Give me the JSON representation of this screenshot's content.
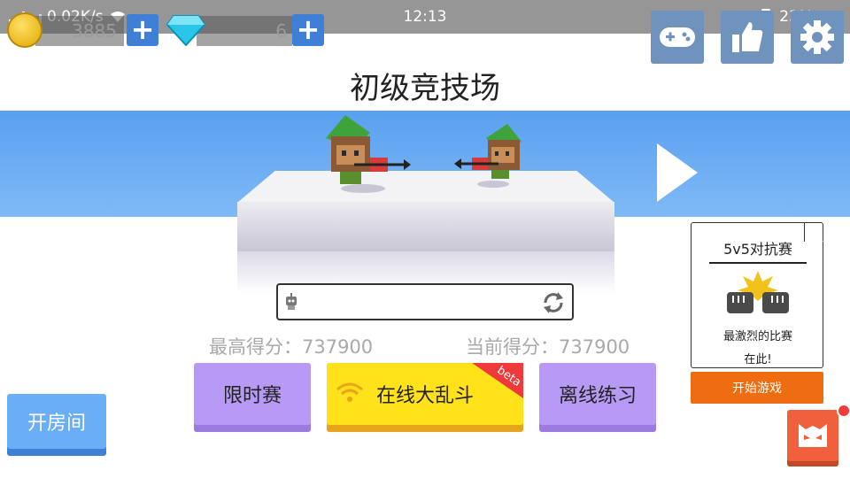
{
  "status_bar": {
    "network_speed": "0.02K/s",
    "time": "12:13",
    "battery": "23%"
  },
  "currency": {
    "coins": "3885",
    "gems": "6"
  },
  "title": "初级竞技场",
  "scores": {
    "best": "最高得分：737900",
    "current": "当前得分：737900"
  },
  "modes": {
    "timed": "限时赛",
    "online": "在线大乱斗",
    "online_badge": "beta",
    "offline": "离线练习"
  },
  "room_button": "开房间",
  "promo_card": {
    "title": "5v5对抗赛",
    "desc_line1": "最激烈的比赛",
    "desc_line2": "在此!",
    "start_label": "开始游戏"
  },
  "icons": [
    "gamepad-icon",
    "thumbs-up-icon",
    "gear-icon",
    "refresh-icon",
    "mail-icon",
    "wifi-icon"
  ]
}
